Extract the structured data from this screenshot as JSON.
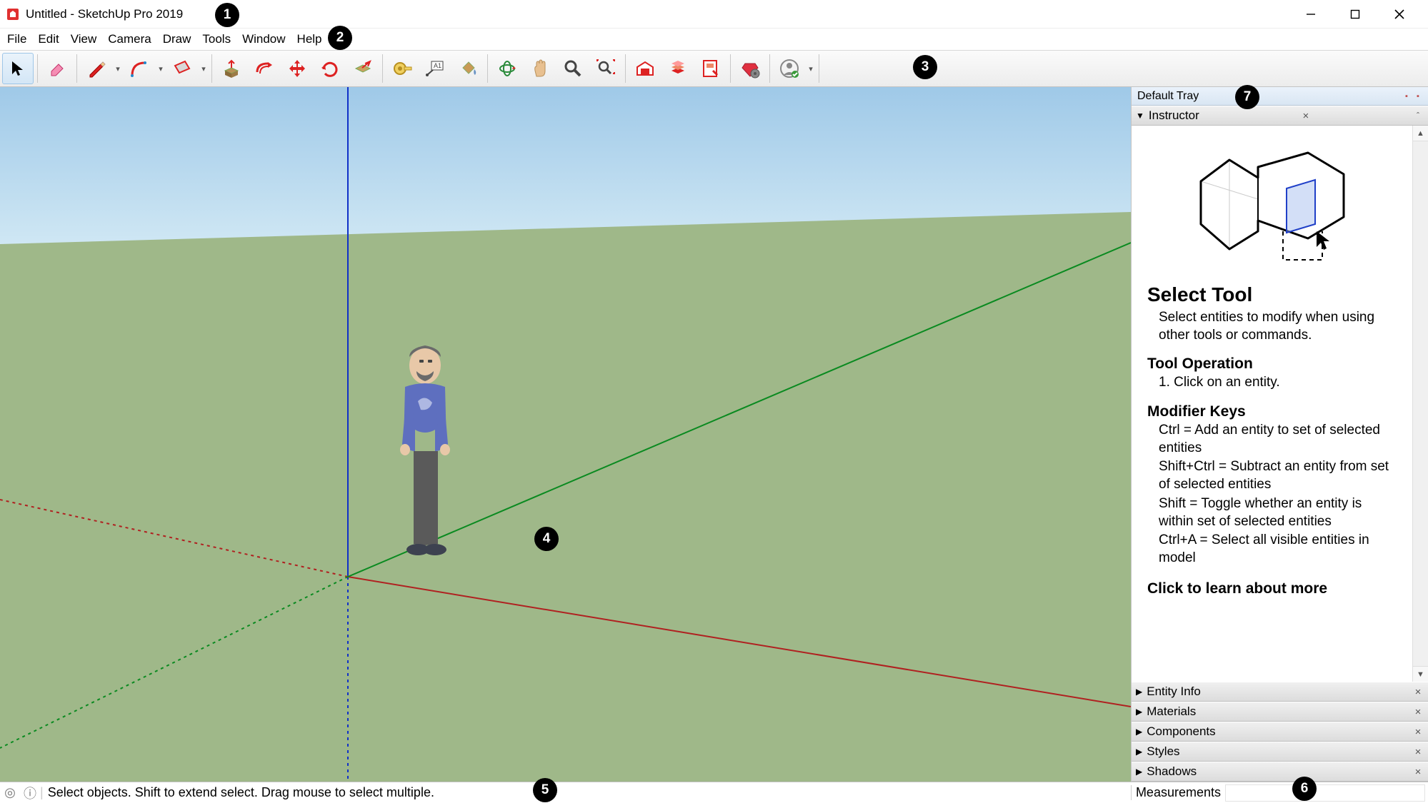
{
  "title": "Untitled - SketchUp Pro 2019",
  "menubar": [
    "File",
    "Edit",
    "View",
    "Camera",
    "Draw",
    "Tools",
    "Window",
    "Help"
  ],
  "toolbar": {
    "groups": [
      [
        "select"
      ],
      [
        "eraser"
      ],
      [
        "pencil",
        "dd"
      ],
      [
        "arcs",
        "dd"
      ],
      [
        "shapes",
        "dd"
      ],
      [
        "pushpull"
      ],
      [
        "offset"
      ],
      [
        "move"
      ],
      [
        "rotate"
      ],
      [
        "scale"
      ],
      [
        "tape"
      ],
      [
        "text"
      ],
      [
        "paint"
      ],
      [
        "orbit"
      ],
      [
        "pan"
      ],
      [
        "zoom"
      ],
      [
        "zoom-extents"
      ],
      [
        "warehouse3d"
      ],
      [
        "warehouse-ext"
      ],
      [
        "layout"
      ],
      [
        "extensions"
      ],
      [
        "account",
        "dd"
      ]
    ]
  },
  "badges": [
    "1",
    "2",
    "3",
    "4",
    "5",
    "6",
    "7"
  ],
  "tray": {
    "title": "Default Tray",
    "instructor": {
      "header": "Instructor",
      "tool_title": "Select Tool",
      "tool_desc": "Select entities to modify when using other tools or commands.",
      "op_title": "Tool Operation",
      "op_1": "1. Click on an entity.",
      "mod_title": "Modifier Keys",
      "mod_1": "Ctrl = Add an entity to set of selected entities",
      "mod_2": "Shift+Ctrl = Subtract an entity from set of selected entities",
      "mod_3": "Shift = Toggle whether an entity is within set of selected entities",
      "mod_4": "Ctrl+A = Select all visible entities in model",
      "learn": "Click to learn about more"
    },
    "panels": [
      "Entity Info",
      "Materials",
      "Components",
      "Styles",
      "Shadows"
    ]
  },
  "status": {
    "text": "Select objects. Shift to extend select. Drag mouse to select multiple.",
    "measurements_label": "Measurements"
  }
}
